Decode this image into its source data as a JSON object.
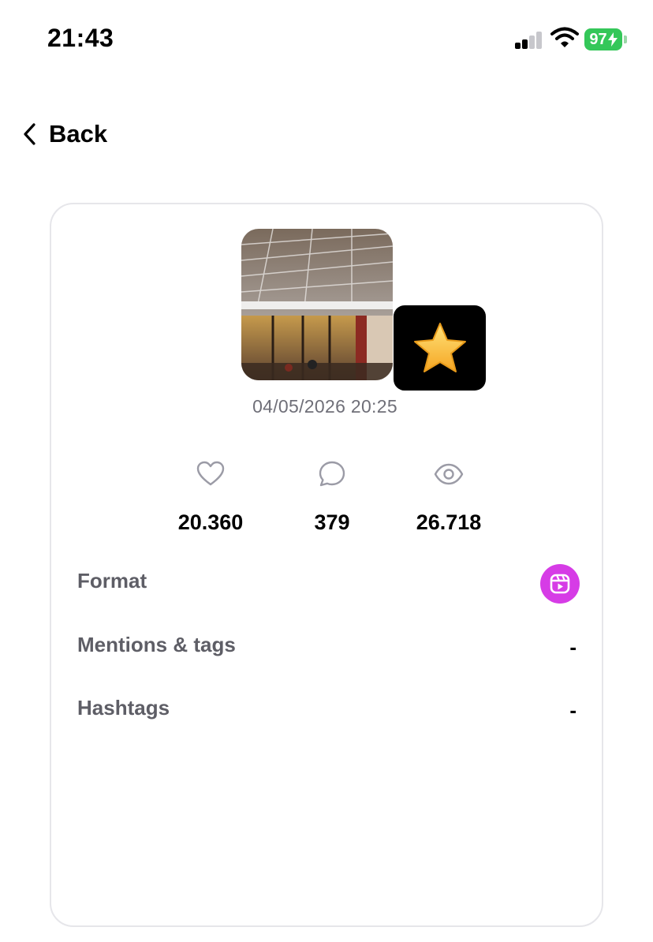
{
  "status_bar": {
    "time": "21:43",
    "battery": "97",
    "battery_color": "#34c759"
  },
  "nav": {
    "back_label": "Back",
    "back_icon": "chevron-left-icon"
  },
  "post": {
    "date": "04/05/2026 20:25",
    "thumbnail_icon": "post-photo",
    "badge_icon": "star-icon",
    "stats": {
      "likes": "20.360",
      "comments": "379",
      "views": "26.718"
    },
    "details": [
      {
        "label": "Format",
        "value": "",
        "icon": "reels-icon",
        "icon_color": "#d63ce6"
      },
      {
        "label": "Mentions & tags",
        "value": "-"
      },
      {
        "label": "Hashtags",
        "value": "-"
      }
    ]
  }
}
